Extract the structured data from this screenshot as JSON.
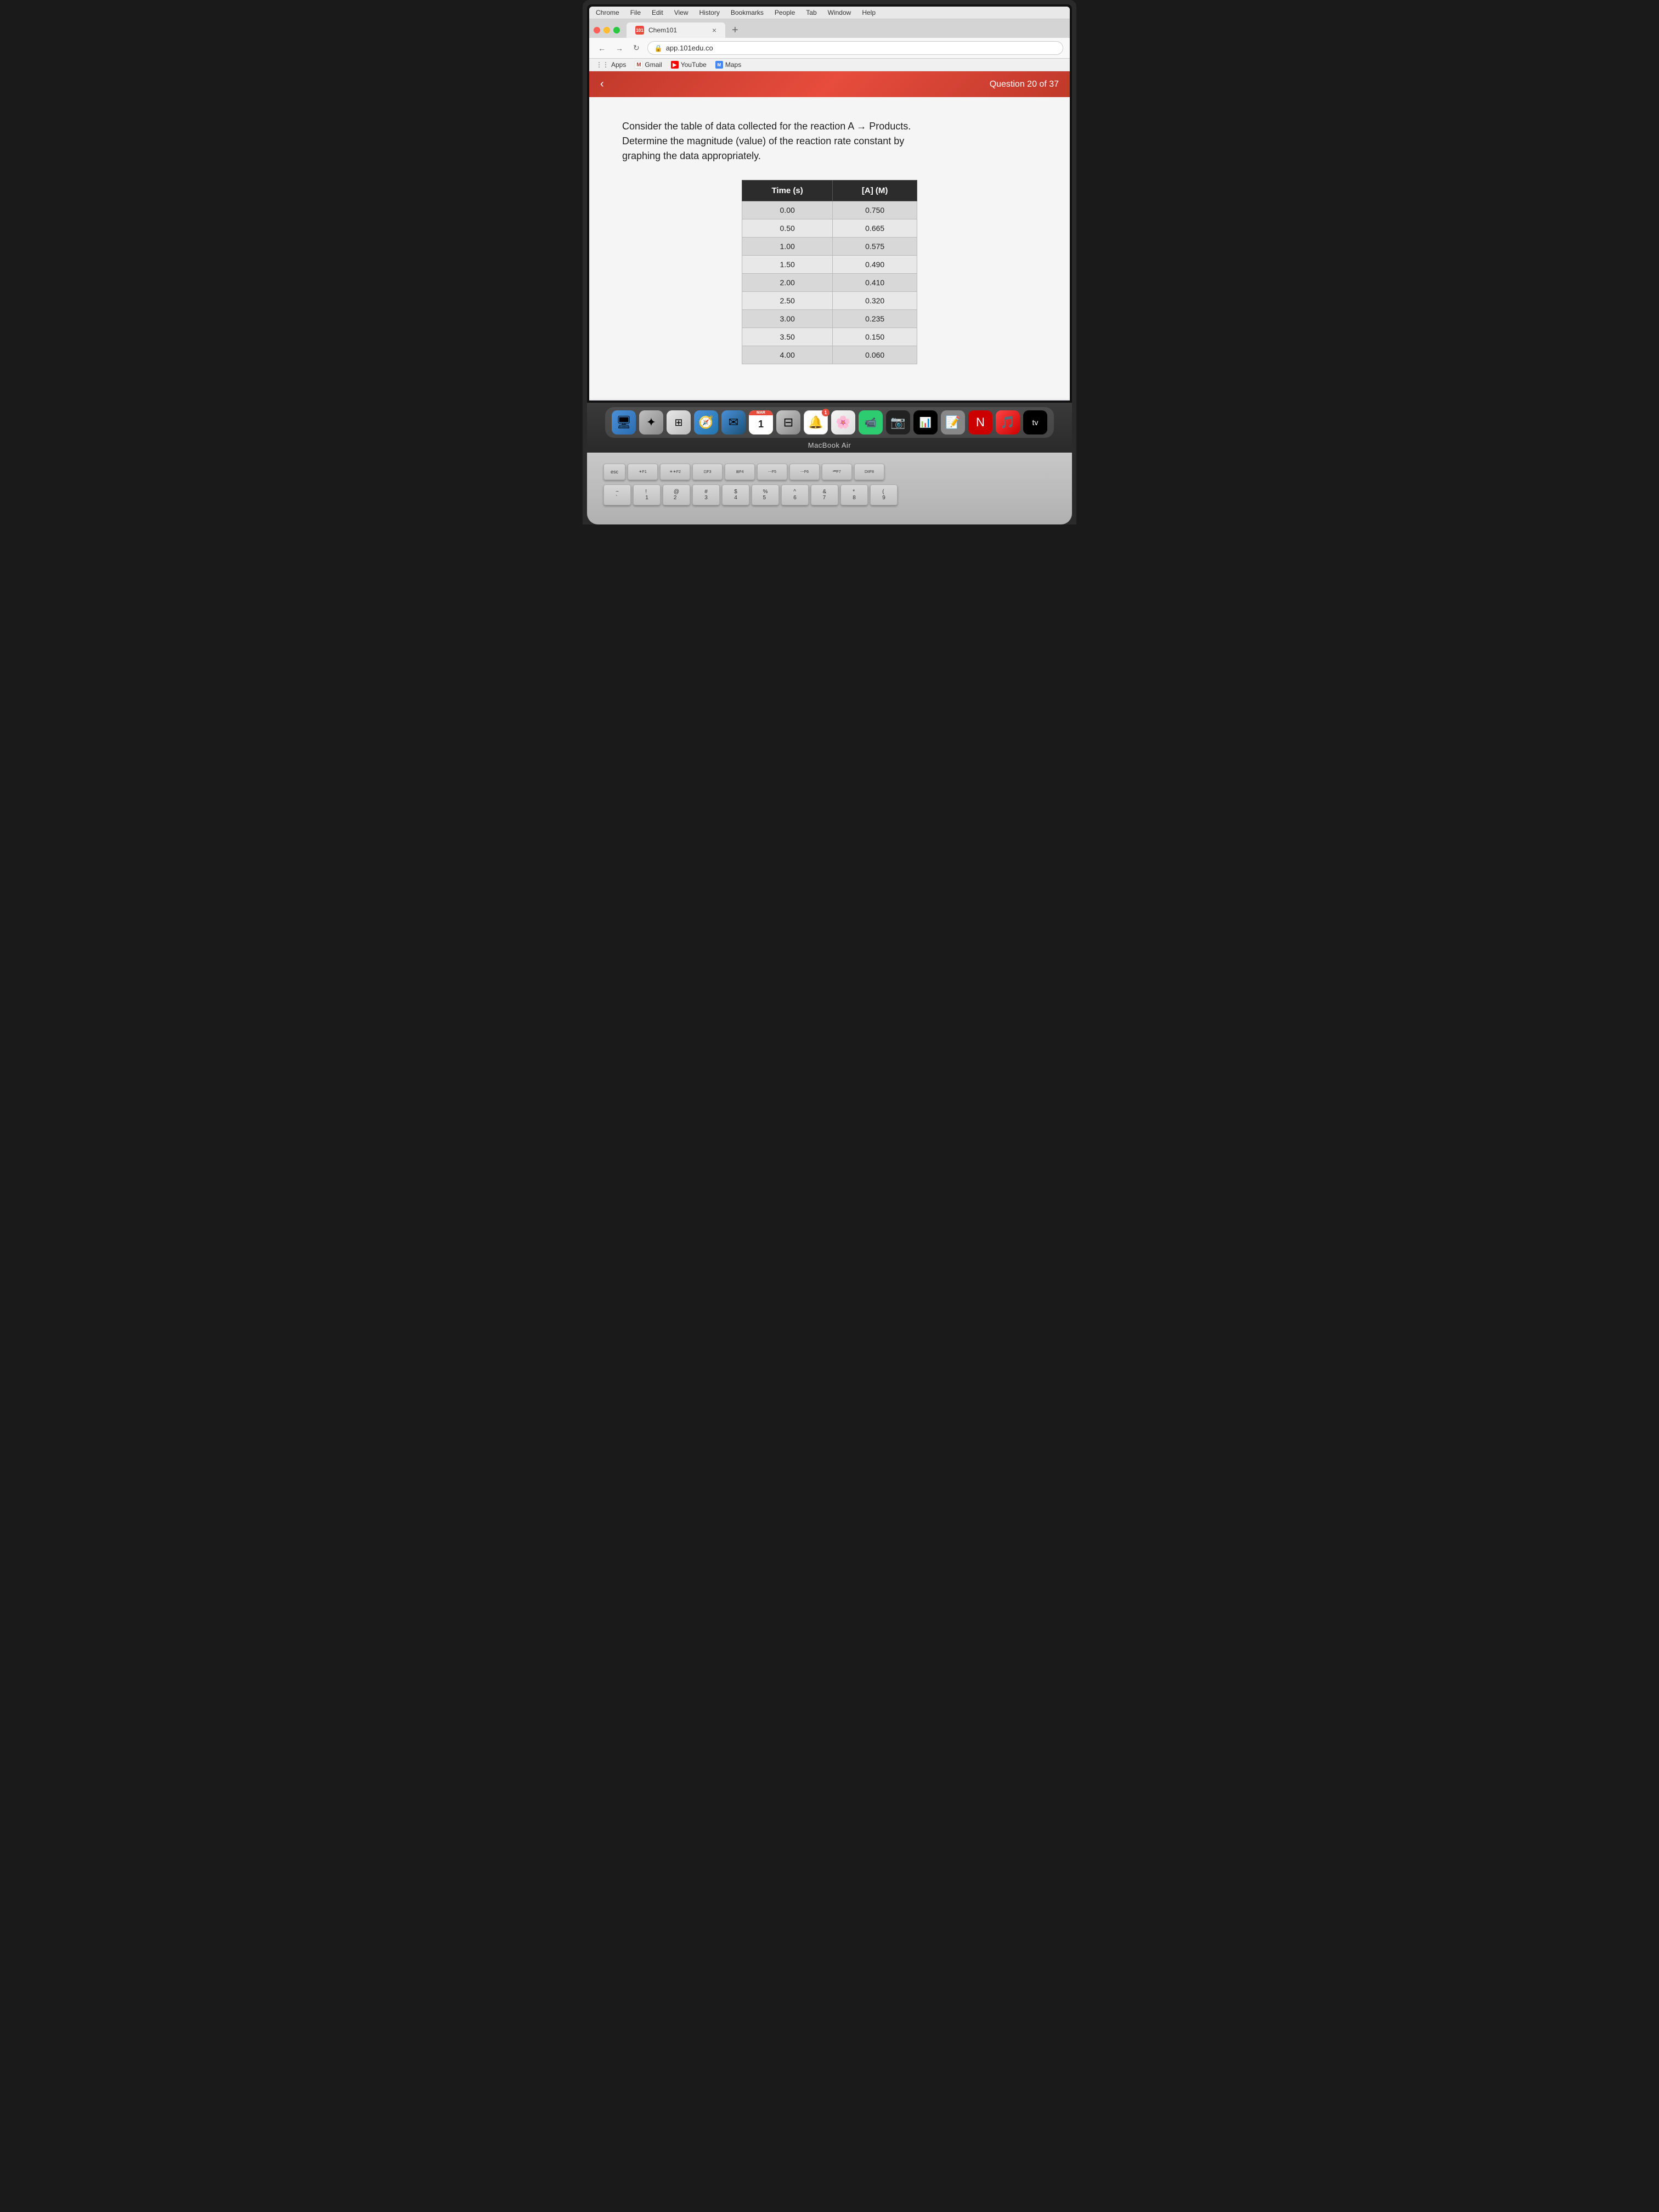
{
  "browser": {
    "menu": {
      "items": [
        "Chrome",
        "File",
        "Edit",
        "View",
        "History",
        "Bookmarks",
        "People",
        "Tab",
        "Window",
        "Help"
      ]
    },
    "tab": {
      "favicon_label": "101",
      "title": "Chem101",
      "close_label": "×"
    },
    "new_tab_label": "+",
    "address": {
      "url": "app.101edu.co",
      "lock_icon": "🔒"
    },
    "bookmarks": [
      {
        "label": "Apps",
        "type": "apps"
      },
      {
        "label": "Gmail",
        "type": "gmail",
        "icon": "M"
      },
      {
        "label": "YouTube",
        "type": "youtube",
        "icon": "▶"
      },
      {
        "label": "Maps",
        "type": "maps",
        "icon": "📍"
      }
    ]
  },
  "page": {
    "question_counter": "Question 20 of 37",
    "back_arrow": "‹",
    "question_text_line1": "Consider the table of data collected for the reaction A → Products.",
    "question_text_line2": "Determine the magnitude (value) of the reaction rate constant by",
    "question_text_line3": "graphing the data appropriately.",
    "table": {
      "headers": [
        "Time (s)",
        "[A] (M)"
      ],
      "rows": [
        [
          "0.00",
          "0.750"
        ],
        [
          "0.50",
          "0.665"
        ],
        [
          "1.00",
          "0.575"
        ],
        [
          "1.50",
          "0.490"
        ],
        [
          "2.00",
          "0.410"
        ],
        [
          "2.50",
          "0.320"
        ],
        [
          "3.00",
          "0.235"
        ],
        [
          "3.50",
          "0.150"
        ],
        [
          "4.00",
          "0.060"
        ]
      ]
    }
  },
  "dock": {
    "calendar_month": "MAR",
    "calendar_day": "1",
    "facetime_badge": "1"
  },
  "macbook_label": "MacBook Air",
  "keyboard": {
    "esc": "esc",
    "f1": "F1",
    "f2": "F2",
    "f3": "F3",
    "f4": "F4",
    "f5": "F5",
    "f6": "F6",
    "f7": "F7",
    "f8": "F8",
    "row1_keys": [
      "~\n`",
      "!\n1",
      "@\n2",
      "#\n3",
      "$\n4",
      "%\n5",
      "^\n6",
      "&\n7",
      "*\n8",
      "(\n9"
    ]
  }
}
